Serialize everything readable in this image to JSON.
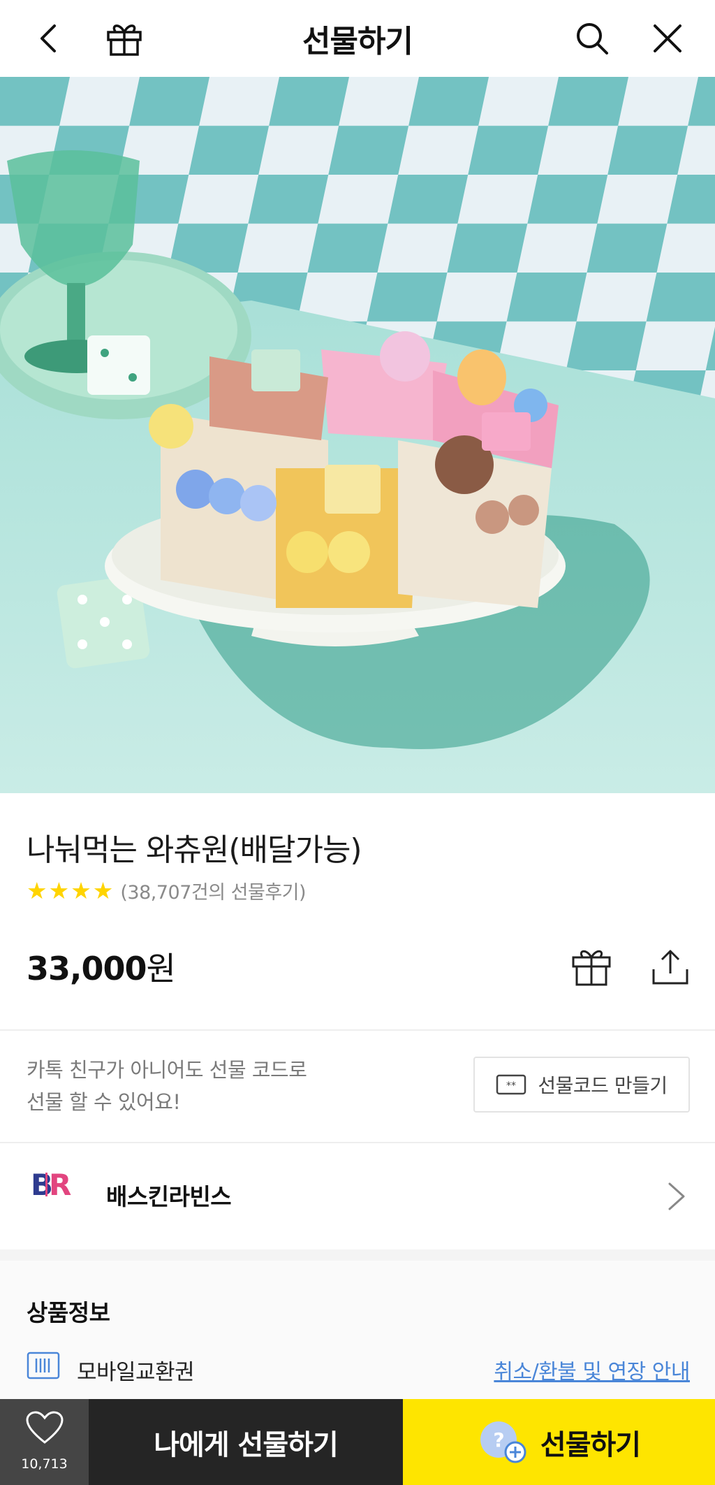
{
  "header": {
    "title": "선물하기",
    "back_icon": "chevron-left-icon",
    "gift_icon": "gift-icon",
    "search_icon": "search-icon",
    "close_icon": "close-icon"
  },
  "product": {
    "name": "나눠먹는 와츄원(배달가능)",
    "rating_stars": 4,
    "review_text": "(38,707건의 선물후기)",
    "price_number": "33,000",
    "price_unit": "원"
  },
  "gift_code": {
    "description_line1": "카톡 친구가 아니어도 선물 코드로",
    "description_line2": "선물 할 수 있어요!",
    "button_label": "선물코드 만들기"
  },
  "brand": {
    "name": "배스킨라빈스"
  },
  "info": {
    "title": "상품정보",
    "type": "모바일교환권",
    "refund_link": "취소/환불 및 연장 안내"
  },
  "bottom_bar": {
    "wish_count": "10,713",
    "self_gift_label": "나에게 선물하기",
    "gift_label": "선물하기"
  },
  "colors": {
    "accent_yellow": "#fee500",
    "star_yellow": "#ffd400",
    "link_blue": "#4a86d8",
    "dark_button": "#252525"
  }
}
